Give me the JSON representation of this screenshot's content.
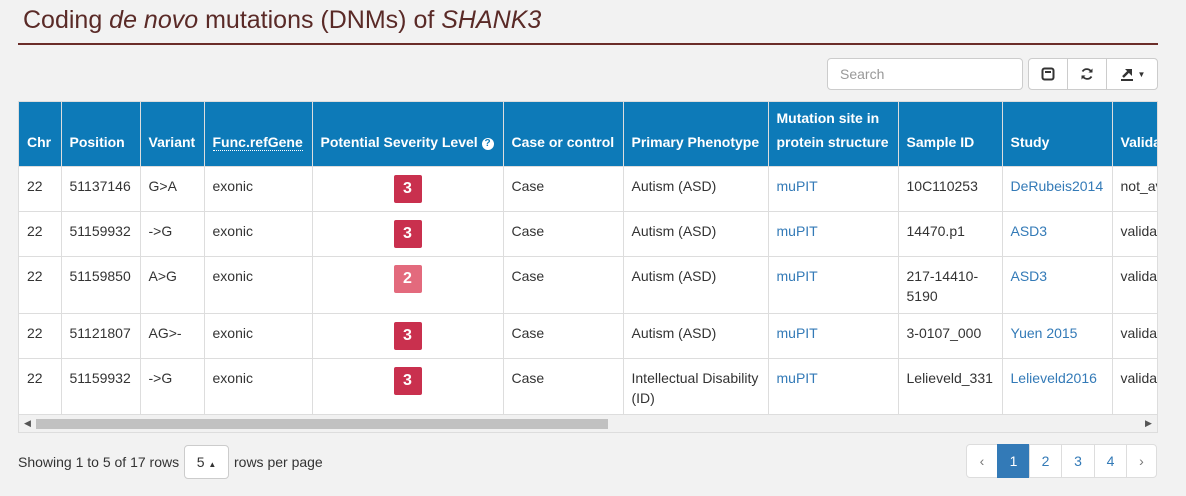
{
  "header": {
    "title_part1": "Coding ",
    "title_italic1": "de novo",
    "title_part2": " mutations (DNMs) of ",
    "title_italic2": "SHANK3"
  },
  "toolbar": {
    "search_placeholder": "Search",
    "buttons": [
      {
        "icon": "toggle-icon"
      },
      {
        "icon": "refresh-icon"
      },
      {
        "icon": "export-icon"
      }
    ]
  },
  "table": {
    "columns": [
      "Chr",
      "Position",
      "Variant",
      "Func.refGene",
      "Potential Severity Level",
      "Case or control",
      "Primary Phenotype",
      "Mutation site in protein structure",
      "Sample ID",
      "Study",
      "Valida"
    ],
    "rows": [
      {
        "chr": "22",
        "position": "51137146",
        "variant": "G>A",
        "func": "exonic",
        "severity": "3",
        "case": "Case",
        "phenotype": "Autism (ASD)",
        "mutation_site": "muPIT",
        "sample": "10C110253",
        "study": "DeRubeis2014",
        "validation": "not_av"
      },
      {
        "chr": "22",
        "position": "51159932",
        "variant": "->G",
        "func": "exonic",
        "severity": "3",
        "case": "Case",
        "phenotype": "Autism (ASD)",
        "mutation_site": "muPIT",
        "sample": "14470.p1",
        "study": "ASD3",
        "validation": "validat"
      },
      {
        "chr": "22",
        "position": "51159850",
        "variant": "A>G",
        "func": "exonic",
        "severity": "2",
        "case": "Case",
        "phenotype": "Autism (ASD)",
        "mutation_site": "muPIT",
        "sample": "217-14410-5190",
        "study": "ASD3",
        "validation": "validat"
      },
      {
        "chr": "22",
        "position": "51121807",
        "variant": "AG>-",
        "func": "exonic",
        "severity": "3",
        "case": "Case",
        "phenotype": "Autism (ASD)",
        "mutation_site": "muPIT",
        "sample": "3-0107_000",
        "study": "Yuen 2015",
        "validation": "validat"
      },
      {
        "chr": "22",
        "position": "51159932",
        "variant": "->G",
        "func": "exonic",
        "severity": "3",
        "case": "Case",
        "phenotype": "Intellectual Disability (ID)",
        "mutation_site": "muPIT",
        "sample": "Lelieveld_331",
        "study": "Lelieveld2016",
        "validation": "validat"
      }
    ],
    "severity_colors": {
      "3": "#c9304e",
      "2": "#e36a7d"
    }
  },
  "footer": {
    "showing_text": "Showing 1 to 5 of 17 rows",
    "page_size": "5",
    "rows_per_page_text": "rows per page",
    "pages": [
      "‹",
      "1",
      "2",
      "3",
      "4",
      "›"
    ],
    "active_page": "1"
  },
  "colors": {
    "header_bg": "#0d7ab8",
    "title": "#5a2a27",
    "link": "#337ab7"
  }
}
